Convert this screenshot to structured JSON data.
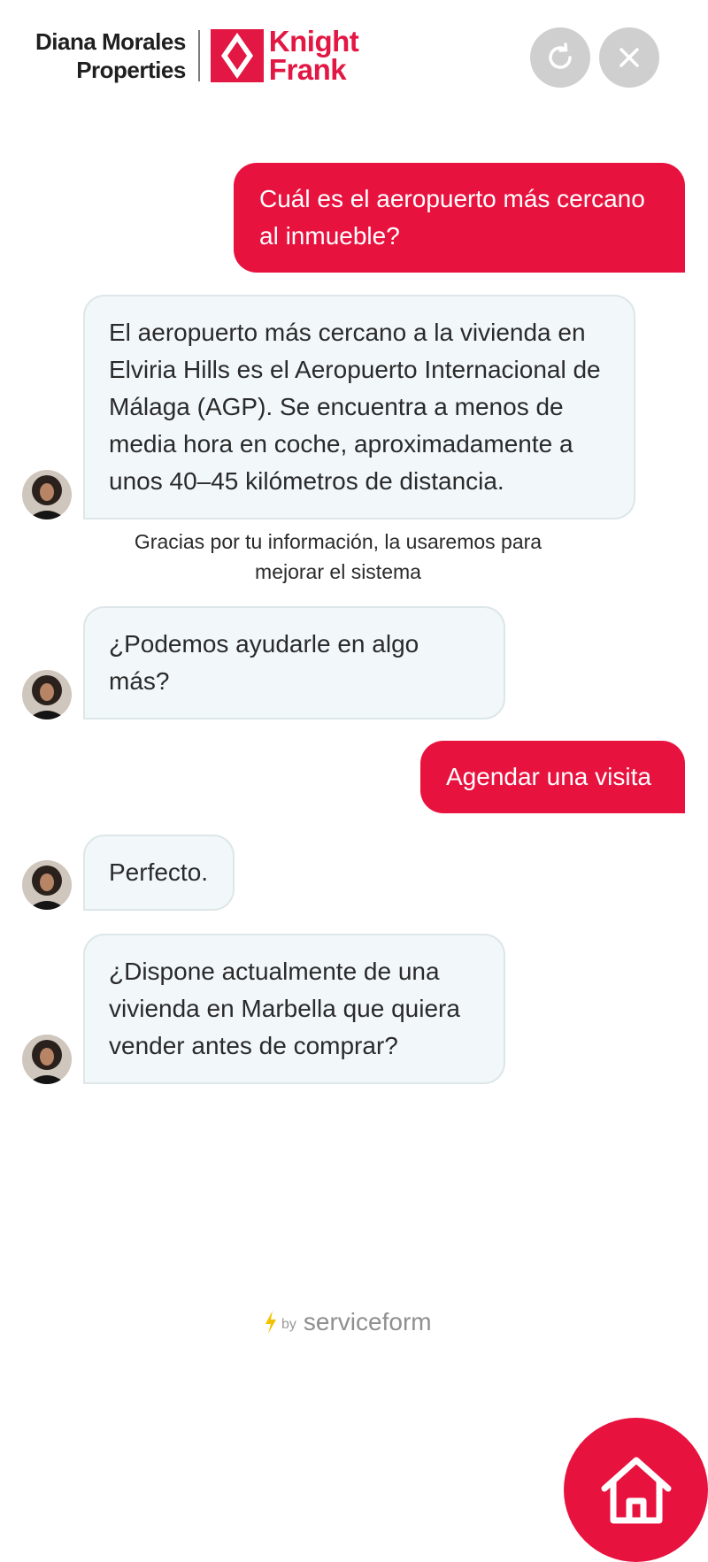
{
  "header": {
    "brand_left_line1": "Diana Morales",
    "brand_left_line2": "Properties",
    "brand_right_line1": "Knight",
    "brand_right_line2": "Frank",
    "refresh_icon": "refresh-icon",
    "close_icon": "close-icon"
  },
  "messages": {
    "user_1": "Cuál es el aeropuerto más cercano al inmueble?",
    "bot_1": "El aeropuerto más cercano a la vivienda en Elviria Hills es el Aeropuerto Internacional de Málaga (AGP). Se encuentra a menos de media hora en coche, aproximadamente a unos 40–45 kilómetros de distancia.",
    "feedback": "Gracias por tu información, la usaremos para mejorar el sistema",
    "bot_2": "¿Podemos ayudarle en algo más?",
    "user_2": "Agendar una visita",
    "bot_3": "Perfecto.",
    "bot_4": "¿Dispone actualmente de una vivienda en Marbella que quiera vender antes de comprar?"
  },
  "footer": {
    "by_label": "by",
    "vendor": "serviceform"
  },
  "launcher": {
    "icon": "home-icon"
  },
  "colors": {
    "accent": "#e8123f",
    "brand_red": "#e31743",
    "bot_bubble_bg": "#f2f8fa",
    "header_button_bg": "#cfcfcf",
    "bolt": "#f2c200"
  }
}
